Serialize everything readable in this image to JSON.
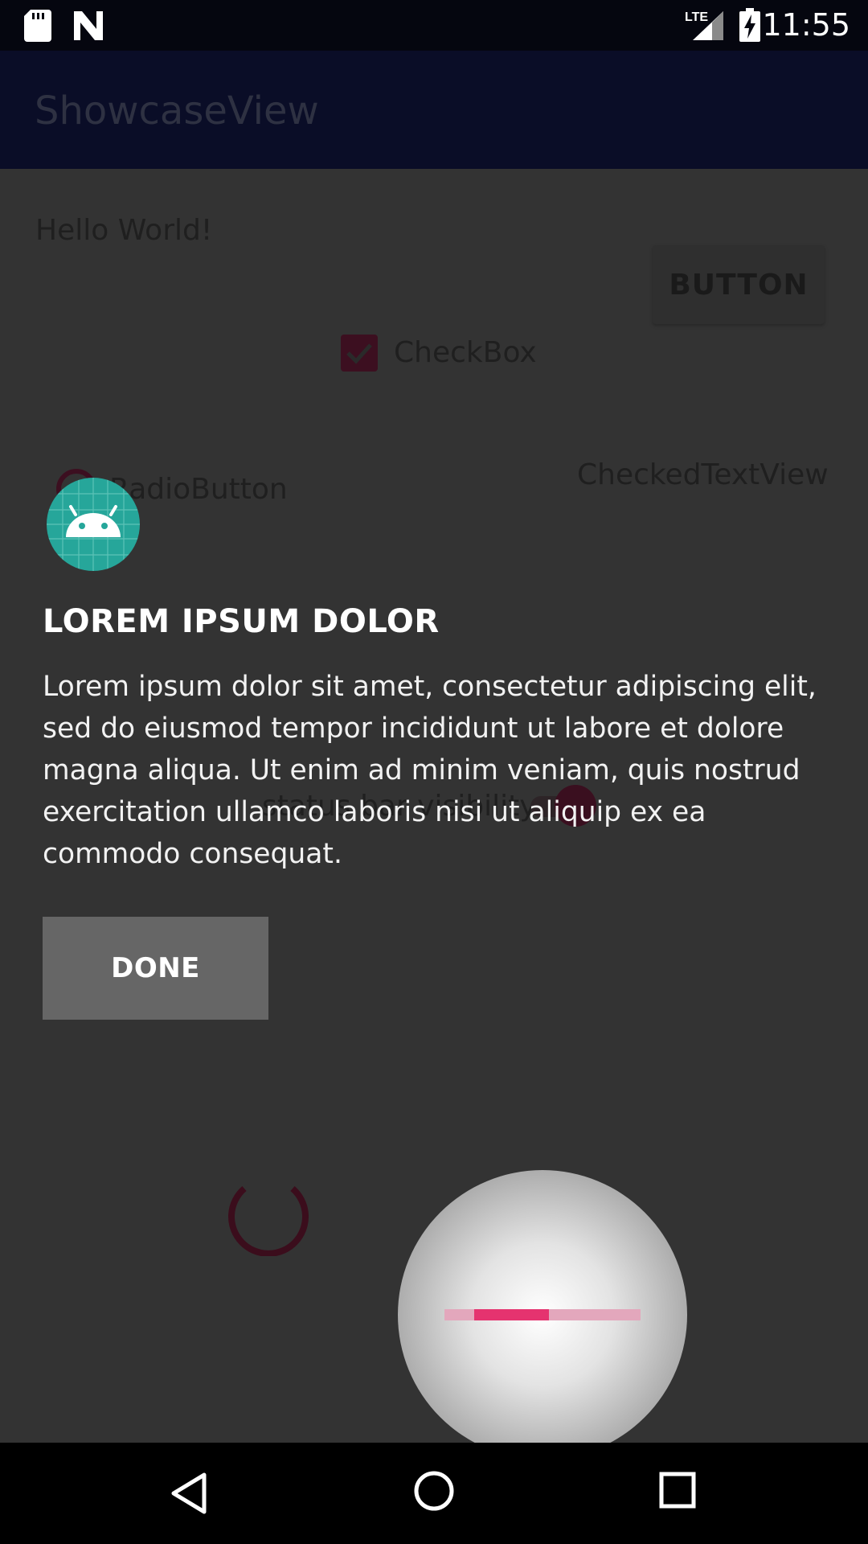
{
  "status_bar": {
    "time": "11:55",
    "network": "LTE",
    "icons": [
      "sd-card-icon",
      "n-notification-icon",
      "lte-signal-icon",
      "battery-charging-icon"
    ]
  },
  "toolbar": {
    "title": "ShowcaseView"
  },
  "background": {
    "text_view": "Hello World!",
    "button_label": "BUTTON",
    "checkbox_label": "CheckBox",
    "radio_label": "RadioButton",
    "checked_text_view": "CheckedTextView",
    "switch_label": "status bar visibility"
  },
  "showcase": {
    "icon": "android-icon",
    "title": "LOREM IPSUM DOLOR",
    "body": "Lorem ipsum dolor sit amet, consectetur adipiscing elit, sed do eiusmod tempor incididunt ut labore et dolore magna aliqua. Ut enim ad minim veniam, quis nostrud exercitation ullamco laboris nisi ut aliquip ex ea commodo consequat.",
    "done_label": "DONE"
  },
  "seekbar": {
    "progress": 0.33,
    "secondary_progress": 1.0,
    "accent": "#e5336f"
  },
  "colors": {
    "accent": "#e91e63",
    "overlay": "#333333",
    "icon_bg": "#26a69a"
  },
  "nav_bar": {
    "icons": [
      "back-icon",
      "home-icon",
      "recents-icon"
    ]
  }
}
